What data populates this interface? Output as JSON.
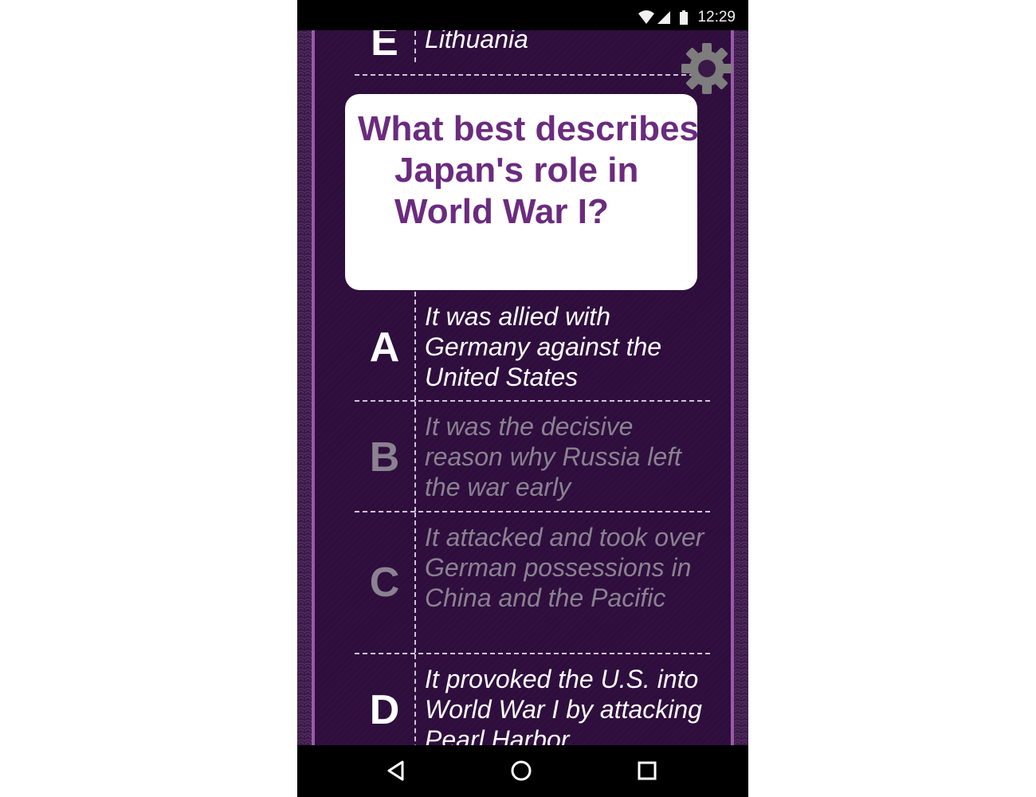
{
  "status_bar": {
    "time": "12:29"
  },
  "question": {
    "text": "What best describes Japan's role in World War I?"
  },
  "answers": {
    "prev": {
      "letter": "E",
      "text": "Lithuania"
    },
    "a": {
      "letter": "A",
      "text": "It was allied with Germany against the United States",
      "dimmed": false
    },
    "b": {
      "letter": "B",
      "text": "It was the decisive reason why Russia left the war early",
      "dimmed": true
    },
    "c": {
      "letter": "C",
      "text": "It attacked and took over German possessions in China and the Pacific",
      "dimmed": true
    },
    "d": {
      "letter": "D",
      "text": "It provoked the U.S. into World War I by attacking Pearl Harbor",
      "dimmed": false
    }
  },
  "icons": {
    "settings": "gear-icon",
    "back": "back-triangle-icon",
    "home": "home-circle-icon",
    "recents": "recents-square-icon"
  },
  "colors": {
    "background": "#2e0d3d",
    "accent": "#6b2b7e",
    "rail": "#9b5aa8",
    "dimmed_text": "#8a8290"
  }
}
